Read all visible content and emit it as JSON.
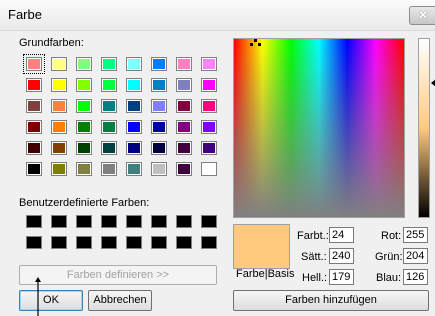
{
  "window": {
    "title": "Farbe",
    "close_icon": "close-icon"
  },
  "basic_colors": {
    "label": "Grundfarben:",
    "swatches": [
      "#ff8080",
      "#ffff80",
      "#80ff80",
      "#00ff80",
      "#80ffff",
      "#0080ff",
      "#ff80c0",
      "#ff80ff",
      "#ff0000",
      "#ffff00",
      "#80ff00",
      "#00ff40",
      "#00ffff",
      "#0080c0",
      "#8080c0",
      "#ff00ff",
      "#804040",
      "#ff8040",
      "#00ff00",
      "#008080",
      "#004080",
      "#8080ff",
      "#800040",
      "#ff0080",
      "#800000",
      "#ff8000",
      "#008000",
      "#008040",
      "#0000ff",
      "#0000a0",
      "#800080",
      "#8000ff",
      "#400000",
      "#804000",
      "#004000",
      "#004040",
      "#000080",
      "#000040",
      "#400040",
      "#400080",
      "#000000",
      "#808000",
      "#808040",
      "#808080",
      "#408080",
      "#c0c0c0",
      "#400040",
      "#ffffff"
    ]
  },
  "custom_colors": {
    "label": "Benutzerdefinierte Farben:"
  },
  "buttons": {
    "define": "Farben definieren >>",
    "ok": "OK",
    "cancel": "Abbrechen",
    "add": "Farben hinzufügen"
  },
  "preview": {
    "label": "Farbe|Basis",
    "color": "#ffc97e"
  },
  "fields": {
    "hue": {
      "label": "Farbt.:",
      "value": "24"
    },
    "sat": {
      "label": "Sätt.:",
      "value": "240"
    },
    "lum": {
      "label": "Hell.:",
      "value": "179"
    },
    "red": {
      "label": "Rot:",
      "value": "255"
    },
    "green": {
      "label": "Grün:",
      "value": "204"
    },
    "blue": {
      "label": "Blau:",
      "value": "126"
    }
  }
}
